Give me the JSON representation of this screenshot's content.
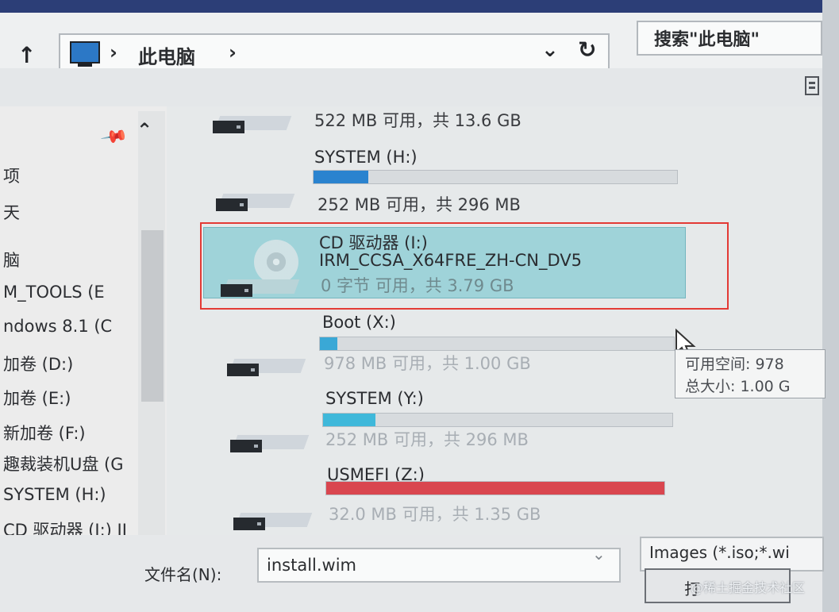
{
  "window": {
    "title": "",
    "colors": {
      "titlebar": "#2c3e77",
      "selection": "#9fd3d9",
      "highlight_border": "#e33a35"
    }
  },
  "address": {
    "crumb": "此电脑",
    "separator": "›"
  },
  "search": {
    "placeholder": "搜索\"此电脑\""
  },
  "nav": {
    "items": [
      {
        "label": "项"
      },
      {
        "label": "天"
      },
      {
        "label": "脑"
      },
      {
        "label": "M_TOOLS (E"
      },
      {
        "label": "ndows 8.1 (C"
      },
      {
        "label": "加卷 (D:)"
      },
      {
        "label": "加卷 (E:)"
      },
      {
        "label": "新加卷 (F:)"
      },
      {
        "label": "趣裁装机U盘 (G"
      },
      {
        "label": "SYSTEM (H:)"
      },
      {
        "label": "CD 驱动器 (I:) II"
      }
    ]
  },
  "drives": [
    {
      "name": "",
      "free_text": "522 MB 可用，共 13.6 GB",
      "usage": null,
      "bar_color": ""
    },
    {
      "name": "SYSTEM (H:)",
      "free_text": "252 MB 可用，共 296 MB",
      "usage": 0.15,
      "bar_color": "#2a83cf"
    },
    {
      "name": "CD 驱动器 (I:)",
      "label": "IRM_CCSA_X64FRE_ZH-CN_DV5",
      "free_text": "0 字节 可用，共 3.79 GB",
      "usage": null,
      "bar_color": ""
    },
    {
      "name": "Boot (X:)",
      "free_text": "978 MB 可用，共 1.00 GB",
      "usage": 0.05,
      "bar_color": "#3aa8d6"
    },
    {
      "name": "SYSTEM (Y:)",
      "free_text": "252 MB 可用，共 296 MB",
      "usage": 0.15,
      "bar_color": "#3fb8da"
    },
    {
      "name": "USMEFI (Z:)",
      "free_text": "32.0 MB 可用，共 1.35 GB",
      "usage": 1.0,
      "bar_color": "#d9464f"
    }
  ],
  "tooltip": {
    "line1": "可用空间: 978",
    "line2": "总大小: 1.00 G"
  },
  "footer": {
    "filename_label": "文件名(N):",
    "filename_value": "install.wim",
    "filter_value": "Images (*.iso;*.wi",
    "open_label": "打"
  },
  "watermark": "@稀土掘金技术社区"
}
